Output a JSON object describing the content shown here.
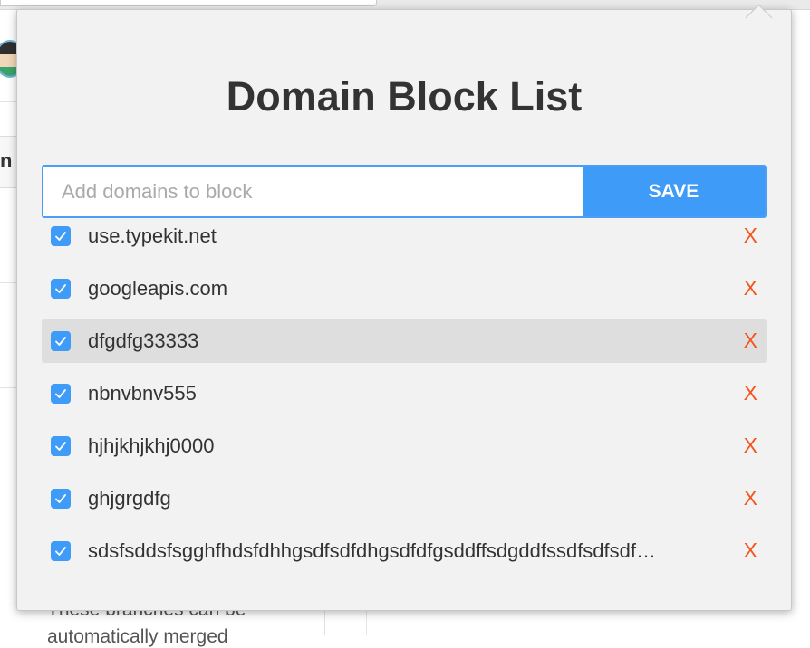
{
  "background": {
    "fragment_label": "n",
    "text_line_1": "These branches can be",
    "text_line_2": "automatically merged"
  },
  "popup": {
    "title": "Domain Block List",
    "input": {
      "placeholder": "Add domains to block",
      "value": ""
    },
    "save_label": "SAVE",
    "remove_label": "X",
    "accent_color": "#3e9bf8",
    "remove_color": "#f5551e",
    "domains": [
      {
        "name": "use.typekit.net",
        "checked": true,
        "highlighted": false
      },
      {
        "name": "googleapis.com",
        "checked": true,
        "highlighted": false
      },
      {
        "name": "dfgdfg33333",
        "checked": true,
        "highlighted": true
      },
      {
        "name": "nbnvbnv555",
        "checked": true,
        "highlighted": false
      },
      {
        "name": "hjhjkhjkhj0000",
        "checked": true,
        "highlighted": false
      },
      {
        "name": "ghjgrgdfg",
        "checked": true,
        "highlighted": false
      },
      {
        "name": "sdsfsddsfsgghfhdsfdhhgsdfsdfdhgsdfdfgsddffsdgddfssdfsdfsdf…",
        "checked": true,
        "highlighted": false
      }
    ]
  }
}
